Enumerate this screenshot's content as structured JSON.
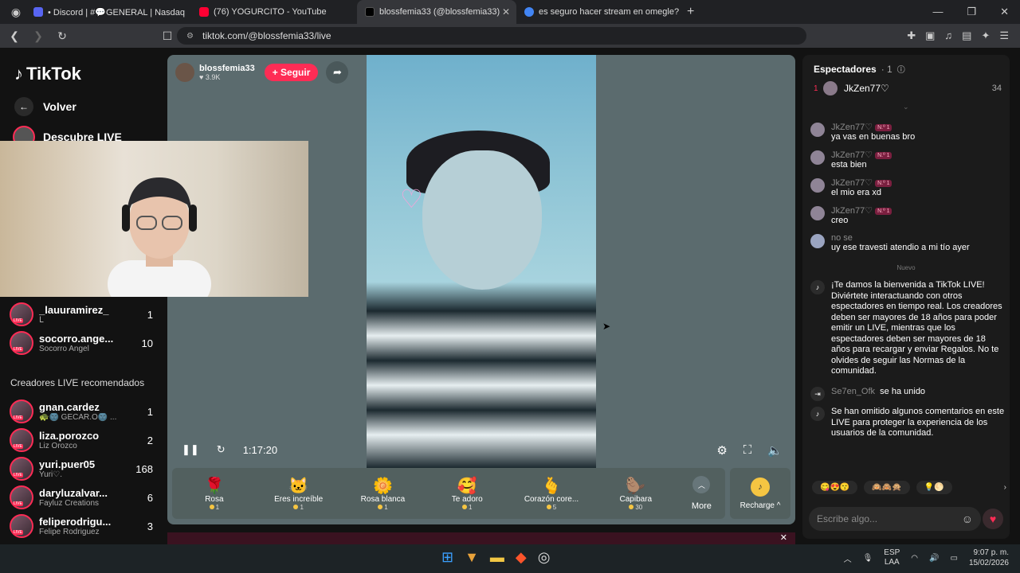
{
  "browser": {
    "tabs": [
      {
        "label": "• Discord | #💬GENERAL | Nasdaq",
        "color": "#5865f2"
      },
      {
        "label": "(76) YOGURCITO - YouTube",
        "color": "#ff0033"
      },
      {
        "label": "blossfemia33 (@blossfemia33)",
        "color": "#000000",
        "active": true
      },
      {
        "label": "es seguro hacer stream en omegle?",
        "color": "#4285f4"
      }
    ],
    "url": "tiktok.com/@blossfemia33/live"
  },
  "sidebar": {
    "logo": "TikTok",
    "back": "Volver",
    "discover": "Descubre LIVE",
    "followed": [
      {
        "name": "_lauuramirez_",
        "sub": "ᒪ",
        "count": "1"
      },
      {
        "name": "socorro.ange...",
        "sub": "Socorro Angel",
        "count": "10"
      }
    ],
    "recommended_title": "Creadores LIVE recomendados",
    "recommended": [
      {
        "name": "gnan.cardez",
        "sub": "🐢🌚 GECAR.O🌚 ...",
        "count": "1"
      },
      {
        "name": "liza.porozco",
        "sub": "Liz Orozco",
        "count": "2"
      },
      {
        "name": "yuri.puer05",
        "sub": "Yuri♡.",
        "count": "168"
      },
      {
        "name": "daryluzalvar...",
        "sub": "Fayluz Creations",
        "count": "6"
      },
      {
        "name": "feliperodrigu...",
        "sub": "Felipe Rodriguez",
        "count": "3"
      }
    ]
  },
  "player": {
    "host": "blossfemia33",
    "likes": "♥ 3.9K",
    "follow": "+ Seguir",
    "time": "1:17:20",
    "gifts": [
      {
        "name": "Rosa",
        "price": "1",
        "icon": "🌹"
      },
      {
        "name": "Eres increíble",
        "price": "1",
        "icon": "🐱"
      },
      {
        "name": "Rosa blanca",
        "price": "1",
        "icon": "🌼"
      },
      {
        "name": "Te adoro",
        "price": "1",
        "icon": "🥰"
      },
      {
        "name": "Corazón core...",
        "price": "5",
        "icon": "🫰"
      },
      {
        "name": "Capibara",
        "price": "30",
        "icon": "🦫"
      }
    ],
    "more": "More",
    "recharge": "Recharge ^"
  },
  "chat": {
    "title": "Espectadores",
    "viewer_count": "· 1",
    "top_viewer": {
      "rank": "1",
      "name": "JkZen77♡",
      "score": "34"
    },
    "messages": [
      {
        "user": "JkZen77♡",
        "badge": "N.º 1",
        "text": "ya vas en buenas bro"
      },
      {
        "user": "JkZen77♡",
        "badge": "N.º 1",
        "text": "esta bien"
      },
      {
        "user": "JkZen77♡",
        "badge": "N.º 1",
        "text": "el mio era xd"
      },
      {
        "user": "JkZen77♡",
        "badge": "N.º 1",
        "text": "creo"
      },
      {
        "user": "no se",
        "badge": "",
        "text": "uy ese travesti atendio a mi tío ayer"
      }
    ],
    "divider": "Nuevo",
    "welcome": "¡Te damos la bienvenida a TikTok LIVE! Diviértete interactuando con otros espectadores en tiempo real. Los creadores deben ser mayores de 18 años para poder emitir un LIVE, mientras que los espectadores deben ser mayores de 18 años para recargar y enviar Regalos. No te olvides de seguir las Normas de la comunidad.",
    "joined_user": "Se7en_Ofk",
    "joined_text": "se ha unido",
    "omitted": "Se han omitido algunos comentarios en este LIVE para proteger la experiencia de los usuarios de la comunidad.",
    "placeholder": "Escribe algo..."
  },
  "taskbar": {
    "lang": "ESP",
    "lang2": "LAA",
    "time": "9:07 p. m.",
    "date": "15/02/2026"
  }
}
